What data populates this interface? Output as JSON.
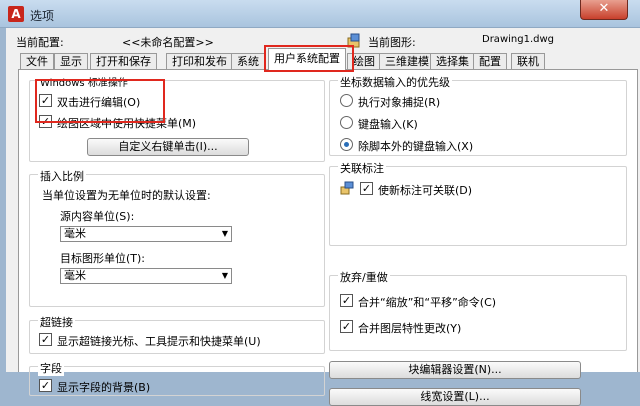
{
  "title": "选项",
  "close_glyph": "✕",
  "current_profile_label": "当前配置:",
  "current_profile_value": "<<未命名配置>>",
  "current_drawing_label": "当前图形:",
  "current_drawing_value": "Drawing1.dwg",
  "tabs": [
    "文件",
    "显示",
    "打开和保存",
    "打印和发布",
    "系统",
    "用户系统配置",
    "绘图",
    "三维建模",
    "选择集",
    "配置",
    "联机"
  ],
  "active_tab": "用户系统配置",
  "windows_group": {
    "title": "Windows 标准操作",
    "double_click_edit": "双击进行编辑(O)",
    "shortcut_menu": "绘图区域中使用快捷菜单(M)",
    "customize_button": "自定义右键单击(I)..."
  },
  "insert_scale": {
    "title": "插入比例",
    "description": "当单位设置为无单位时的默认设置:",
    "source_label": "源内容单位(S):",
    "source_value": "毫米",
    "target_label": "目标图形单位(T):",
    "target_value": "毫米"
  },
  "hyperlink": {
    "title": "超链接",
    "option": "显示超链接光标、工具提示和快捷菜单(U)"
  },
  "fields": {
    "title": "字段",
    "option": "显示字段的背景(B)"
  },
  "coord_priority": {
    "title": "坐标数据输入的优先级",
    "options": [
      "执行对象捕捉(R)",
      "键盘输入(K)",
      "除脚本外的键盘输入(X)"
    ],
    "selected": "除脚本外的键盘输入(X)"
  },
  "associative_dim": {
    "title": "关联标注",
    "option": "使新标注可关联(D)"
  },
  "undo_redo": {
    "title": "放弃/重做",
    "combine_zoom_pan": "合并“缩放”和“平移”命令(C)",
    "combine_layer": "合并图层特性更改(Y)"
  },
  "block_editor_button": "块编辑器设置(N)...",
  "lineweight_button": "线宽设置(L)...",
  "check_glyph": "✓",
  "colors": {
    "highlight": "#e0281e",
    "titlebar": "#b7cde3",
    "radio_dot": "#2a6eb8"
  }
}
